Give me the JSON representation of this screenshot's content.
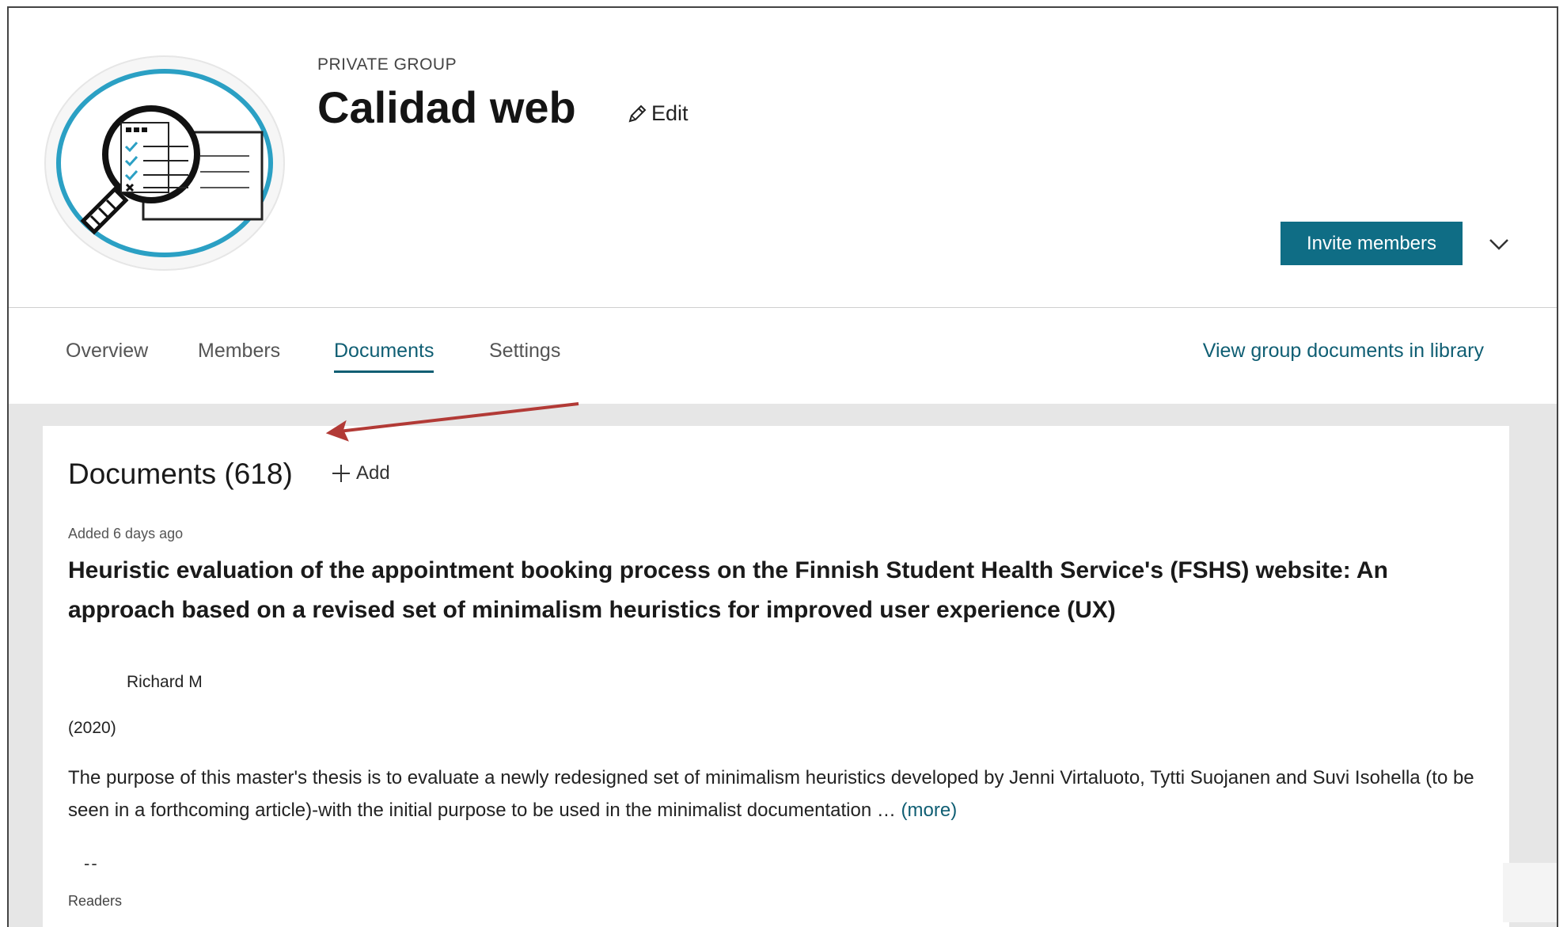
{
  "header": {
    "group_type": "PRIVATE GROUP",
    "title": "Calidad web",
    "edit_label": "Edit",
    "invite_label": "Invite members",
    "logo_icon": "magnifier-checklist-icon"
  },
  "nav": {
    "tabs": [
      {
        "label": "Overview",
        "active": false
      },
      {
        "label": "Members",
        "active": false
      },
      {
        "label": "Documents",
        "active": true
      },
      {
        "label": "Settings",
        "active": false
      }
    ],
    "view_library_label": "View group documents in library"
  },
  "documents": {
    "heading": "Documents (618)",
    "add_label": "Add",
    "items": [
      {
        "added": "Added 6 days ago",
        "title": "Heuristic evaluation of the appointment booking process on the Finnish Student Health Service's (FSHS) website: An approach based on a revised set of minimalism heuristics for improved user experience (UX)",
        "author": "Richard M",
        "year": "(2020)",
        "abstract": "The purpose of this master's thesis is to evaluate a newly redesigned set of minimalism heuristics developed by Jenni Virtaluoto, Tytti Suojanen and Suvi Isohella (to be seen in a forthcoming article)-with the initial purpose to be used in the minimalist documentation …",
        "more_label": "(more)",
        "readers_count": "--",
        "readers_label": "Readers"
      }
    ]
  },
  "colors": {
    "accent": "#0f6d85",
    "link": "#0f5e73",
    "annotation_arrow": "#b23a36",
    "content_bg": "#e6e6e6"
  }
}
